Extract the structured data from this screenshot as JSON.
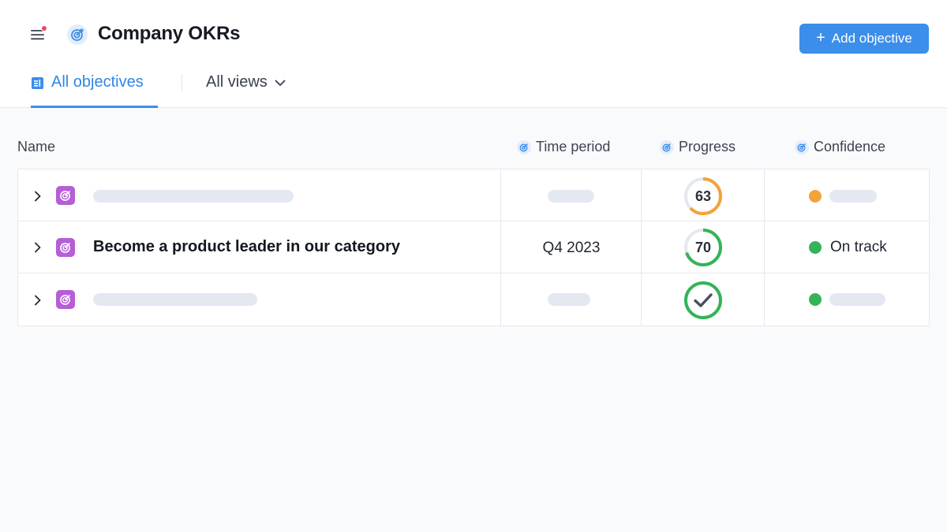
{
  "header": {
    "title": "Company OKRs",
    "add_button_label": "Add objective",
    "menu_icon": "hamburger-menu-icon",
    "title_icon": "target-icon"
  },
  "tabs": {
    "all_objectives": "All objectives",
    "all_views": "All views"
  },
  "columns": {
    "name": "Name",
    "time_period": "Time period",
    "progress": "Progress",
    "confidence": "Confidence"
  },
  "rows": [
    {
      "title": "",
      "time_period": "",
      "progress": 63,
      "progress_label": "63",
      "progress_color": "#f2a33a",
      "confidence_color": "#f2a33a",
      "confidence_label": ""
    },
    {
      "title": "Become a product leader in our category",
      "time_period": "Q4 2023",
      "progress": 70,
      "progress_label": "70",
      "progress_color": "#34b35a",
      "confidence_color": "#34b35a",
      "confidence_label": "On track"
    },
    {
      "title": "",
      "time_period": "",
      "progress": 100,
      "progress_label": "",
      "progress_color": "#34b35a",
      "confidence_color": "#34b35a",
      "confidence_label": ""
    }
  ],
  "colors": {
    "accent": "#3b8eea",
    "objective_icon": "#b65ed6",
    "notification": "#ef4b5c"
  }
}
